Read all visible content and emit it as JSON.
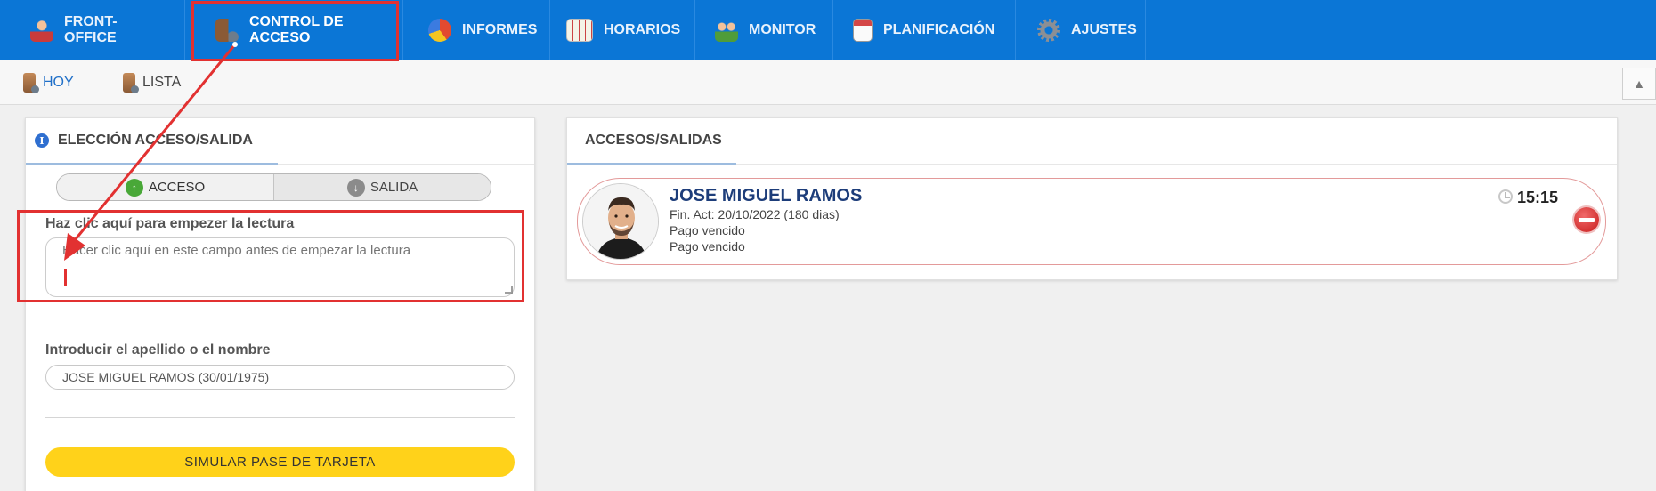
{
  "topnav": {
    "items": [
      {
        "label": "FRONT-OFFICE",
        "icon": "front-office-person-icon",
        "color": "#c93b3b"
      },
      {
        "label": "CONTROL DE ACCESO",
        "icon": "door-access-icon",
        "color": "#b9794a"
      },
      {
        "label": "INFORMES",
        "icon": "pie-chart-icon",
        "color": "#e24a2f"
      },
      {
        "label": "HORARIOS",
        "icon": "calendar-grid-icon",
        "color": "#d9d9c6"
      },
      {
        "label": "MONITOR",
        "icon": "people-monitor-icon",
        "color": "#4f9c3a"
      },
      {
        "label": "PLANIFICACIÓN",
        "icon": "calendar-icon",
        "color": "#d44646"
      },
      {
        "label": "AJUSTES",
        "icon": "gear-icon",
        "color": "#8c8f94"
      }
    ],
    "active_index": 1,
    "background": "#0b76d6"
  },
  "subnav": {
    "items": [
      {
        "label": "HOY",
        "icon": "door-person-icon",
        "active": true
      },
      {
        "label": "LISTA",
        "icon": "door-person-icon",
        "active": false
      }
    ],
    "pin_icon": "pin-icon",
    "active_color": "#1f6fc8"
  },
  "left_panel": {
    "title": "ELECCIÓN ACCESO/SALIDA",
    "toggle": {
      "access_label": "ACCESO",
      "exit_label": "SALIDA",
      "selected": "ACCESO"
    },
    "reader": {
      "label": "Haz clic aquí para empezer la lectura",
      "placeholder": "Hacer clic aquí en este campo antes de empezar la lectura",
      "value": ""
    },
    "name_search": {
      "label": "Introducir el apellido o el nombre",
      "value": "JOSE MIGUEL RAMOS (30/01/1975)"
    },
    "simulate_button": "SIMULAR PASE DE TARJETA"
  },
  "right_panel": {
    "title": "ACCESOS/SALIDAS",
    "entries": [
      {
        "name": "JOSE MIGUEL RAMOS",
        "membership_end": "Fin. Act: 20/10/2022 (180 dias)",
        "notes": [
          "Pago vencido",
          "Pago vencido"
        ],
        "time": "15:15",
        "status": "denied",
        "status_icon": "access-denied-icon",
        "border_color": "#e39a9a"
      }
    ]
  },
  "accent_yellow": "#ffd21a",
  "annotation_color": "#e23131"
}
